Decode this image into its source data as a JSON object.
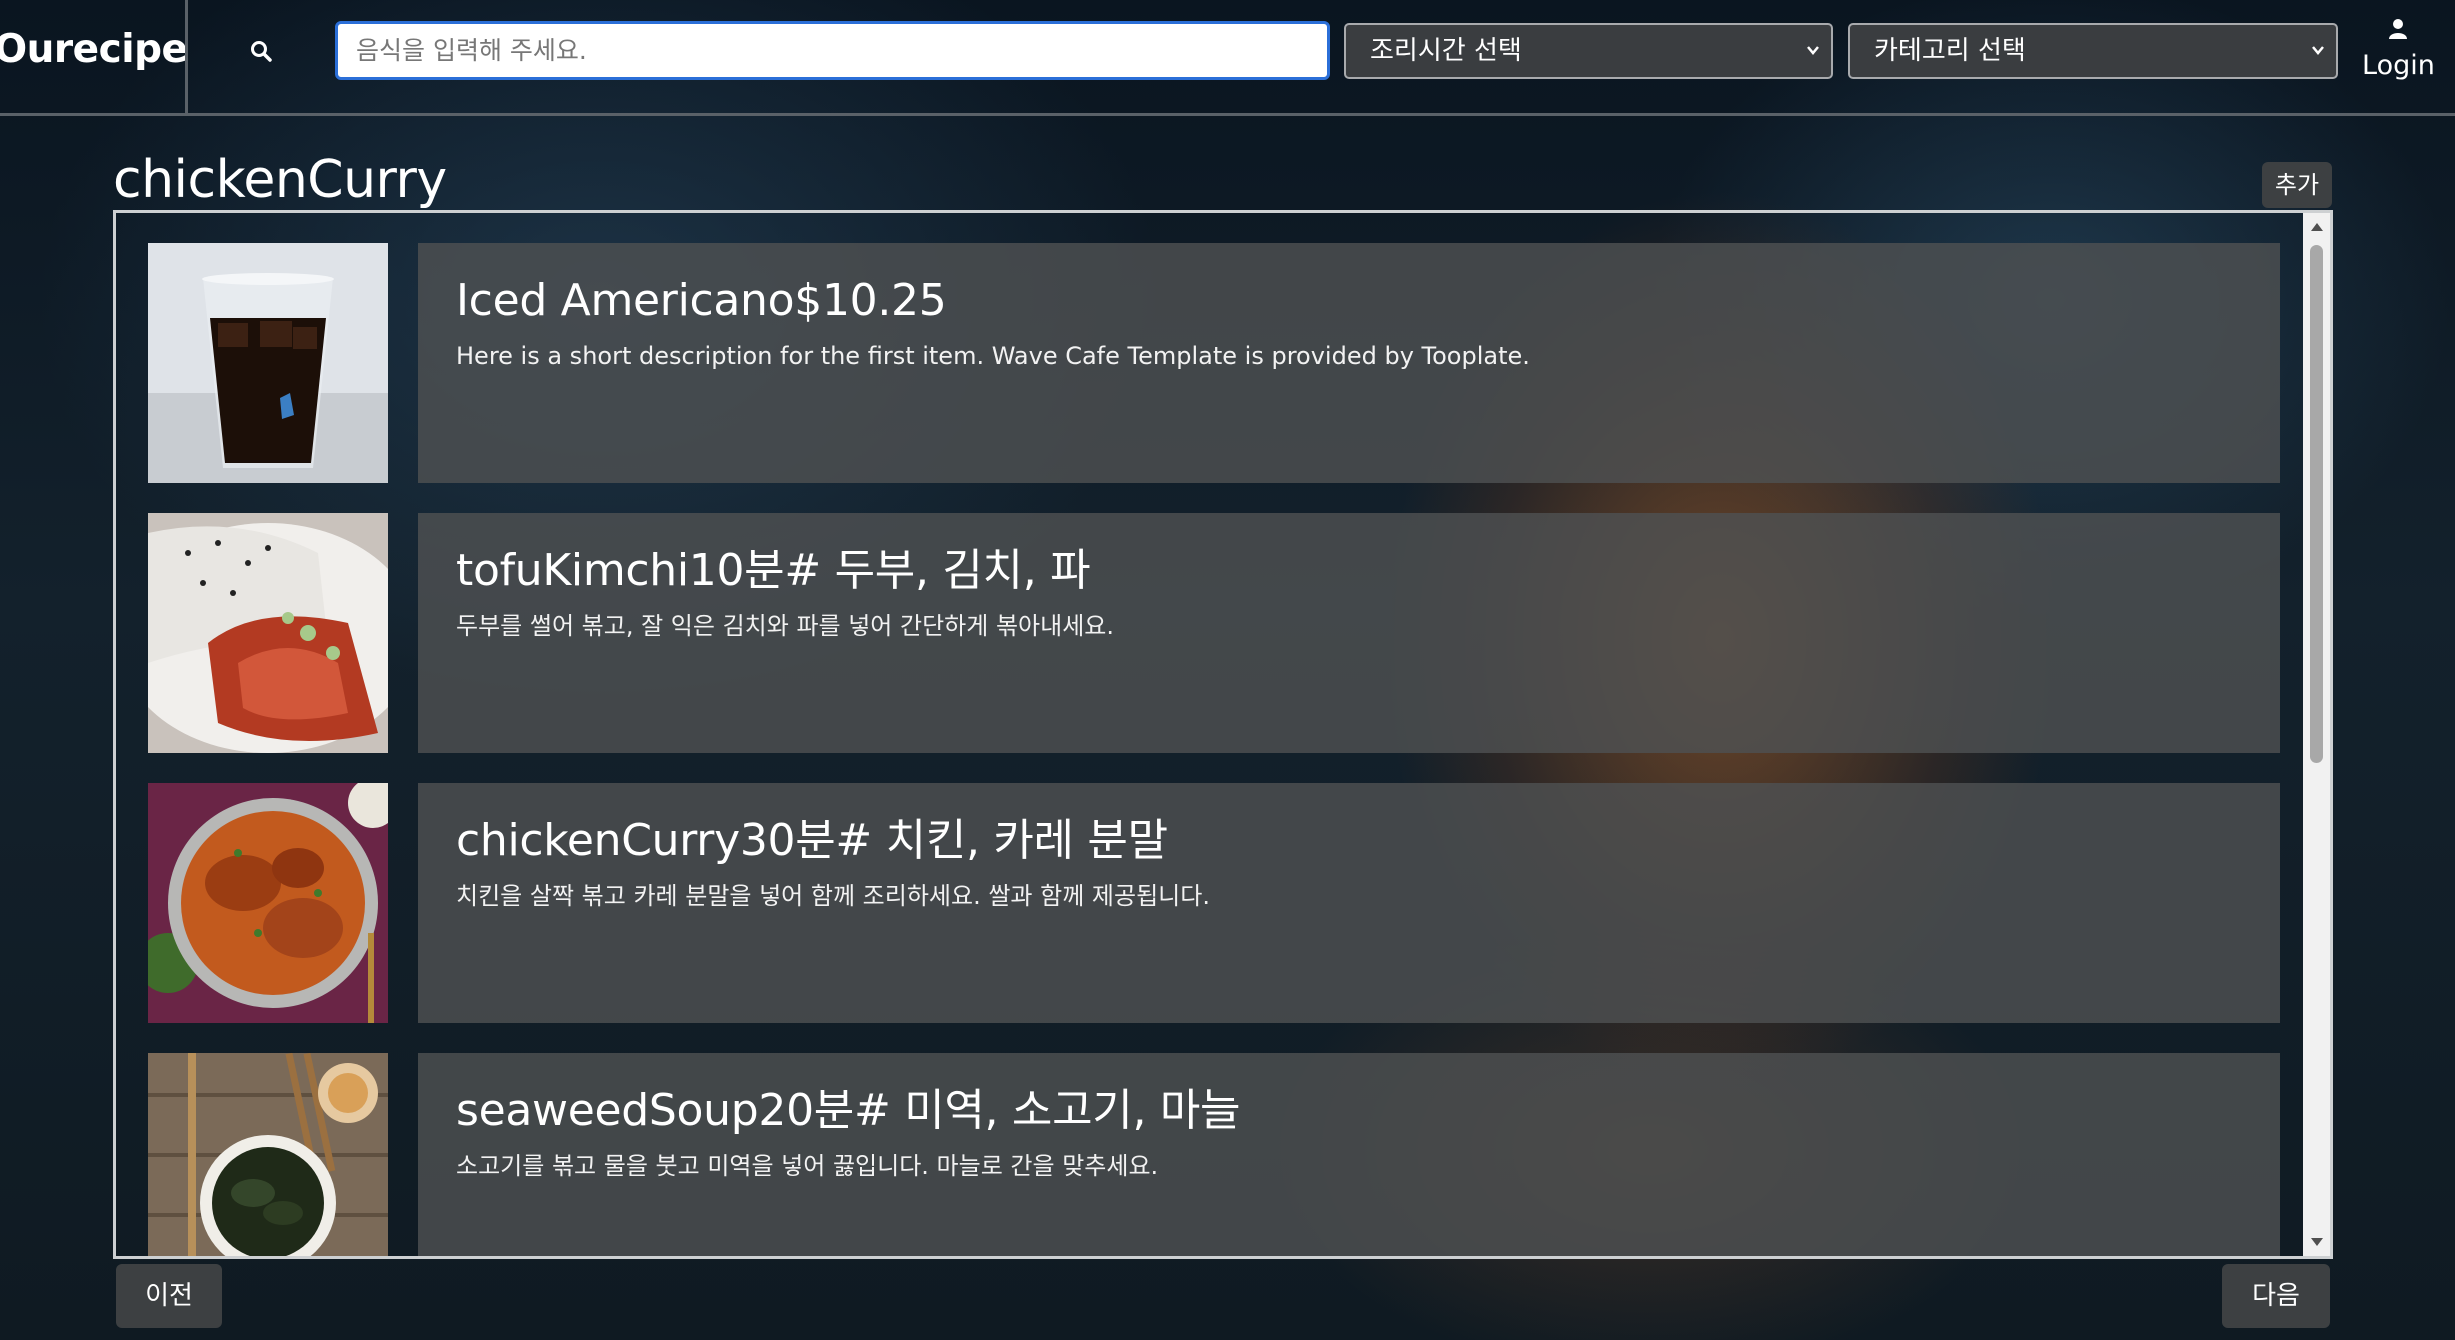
{
  "header": {
    "logo": "Ourecipe",
    "search_placeholder": "음식을 입력해 주세요.",
    "time_select": "조리시간 선택",
    "category_select": "카테고리 선택",
    "login_label": "Login"
  },
  "main": {
    "title": "chickenCurry",
    "add_label": "추가"
  },
  "items": [
    {
      "title": "Iced Americano$10.25",
      "description": "Here is a short description for the first item. Wave Cafe Template is provided by Tooplate.",
      "image_icon": "iced-coffee-image"
    },
    {
      "title": "tofuKimchi10분# 두부, 김치, 파",
      "description": "두부를 썰어 볶고, 잘 익은 김치와 파를 넣어 간단하게 볶아내세요.",
      "image_icon": "tofu-kimchi-image"
    },
    {
      "title": "chickenCurry30분# 치킨, 카레 분말",
      "description": "치킨을 살짝 볶고 카레 분말을 넣어 함께 조리하세요. 쌀과 함께 제공됩니다.",
      "image_icon": "chicken-curry-image"
    },
    {
      "title": "seaweedSoup20분# 미역, 소고기, 마늘",
      "description": "소고기를 볶고 물을 붓고 미역을 넣어 끓입니다. 마늘로 간을 맞추세요.",
      "image_icon": "seaweed-soup-image"
    }
  ],
  "pagination": {
    "prev_label": "이전",
    "next_label": "다음"
  }
}
